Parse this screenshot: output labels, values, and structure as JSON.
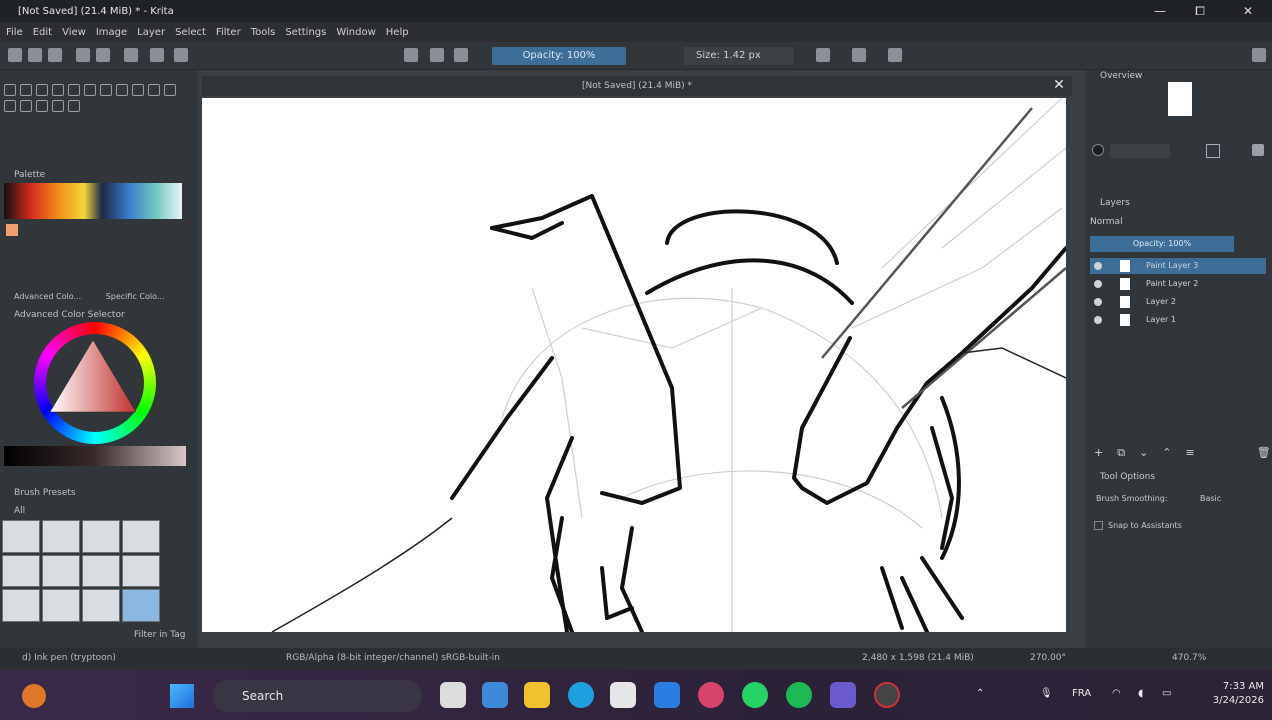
{
  "window": {
    "title": "[Not Saved] (21.4 MiB) * - Krita",
    "controls": {
      "minimize": "—",
      "maximize": "⧠",
      "close": "✕"
    }
  },
  "menu": [
    "File",
    "Edit",
    "View",
    "Image",
    "Layer",
    "Select",
    "Filter",
    "Tools",
    "Settings",
    "Window",
    "Help"
  ],
  "toolbar": {
    "opacity": "Opacity: 100%",
    "size": "Size: 1.42 px"
  },
  "left_dock": {
    "palette_label": "Palette",
    "advanced_color_selector": "Advanced Color Selector",
    "tabs": [
      "Advanced Colo...",
      "Specific Colo..."
    ],
    "brush_presets": "Brush Presets",
    "brush_filter": "All",
    "filter_in_tag": "Filter in Tag"
  },
  "canvas": {
    "tab_title": "[Not Saved] (21.4 MiB) *"
  },
  "right_dock": {
    "overview": "Overview",
    "layers": "Layers",
    "blending": "Normal",
    "opacity": "Opacity: 100%",
    "layer_list": [
      {
        "name": "Paint Layer 3",
        "active": true
      },
      {
        "name": "Paint Layer 2",
        "active": false
      },
      {
        "name": "Layer 2",
        "active": false
      },
      {
        "name": "Layer 1",
        "active": false
      }
    ],
    "tool_options": "Tool Options",
    "brush_smoothing_label": "Brush Smoothing:",
    "brush_smoothing_value": "Basic",
    "snap_to_assistants": "Snap to Assistants"
  },
  "status": {
    "brush": "d) Ink pen (tryptoon)",
    "color_space": "RGB/Alpha (8-bit integer/channel)  sRGB-built-in",
    "dimensions": "2,480 x 1,598 (21.4 MiB)",
    "rotation": "270.00°",
    "zoom": "470.7%"
  },
  "taskbar": {
    "search_placeholder": "Search",
    "time": "7:33 AM",
    "date": "3/24/2026",
    "lang": "FRA"
  },
  "colors": {
    "accent": "#3d6e98",
    "window_bg": "#31363b",
    "canvas": "#ffffff"
  }
}
